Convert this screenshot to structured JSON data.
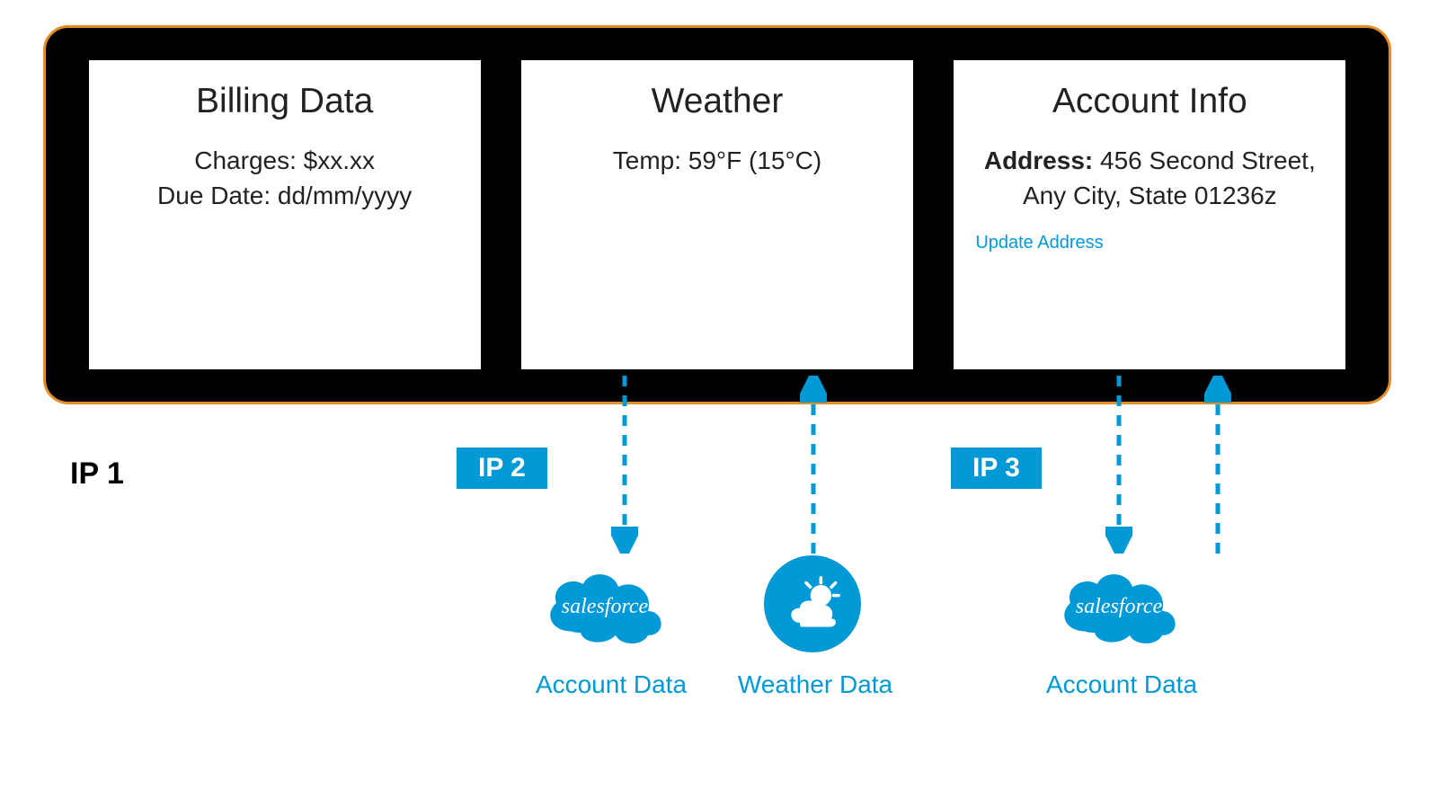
{
  "colors": {
    "accent": "#0099d8",
    "outline": "#e58e26",
    "container_bg": "#000000"
  },
  "cards": {
    "billing": {
      "title": "Billing Data",
      "charges_label": "Charges:",
      "charges_value": "$xx.xx",
      "due_label": "Due Date:",
      "due_value": "dd/mm/yyyy"
    },
    "weather": {
      "title": "Weather",
      "temp_label": "Temp:",
      "temp_value": "59°F (15°C)"
    },
    "account": {
      "title": "Account Info",
      "address_label": "Address:",
      "address_value": "456 Second Street, Any City, State 01236z",
      "update_link": "Update Address"
    }
  },
  "ips": {
    "ip1": "IP 1",
    "ip2": "IP 2",
    "ip3": "IP 3"
  },
  "sources": {
    "sf_name": "salesforce",
    "account_data": "Account Data",
    "weather_data": "Weather Data"
  }
}
